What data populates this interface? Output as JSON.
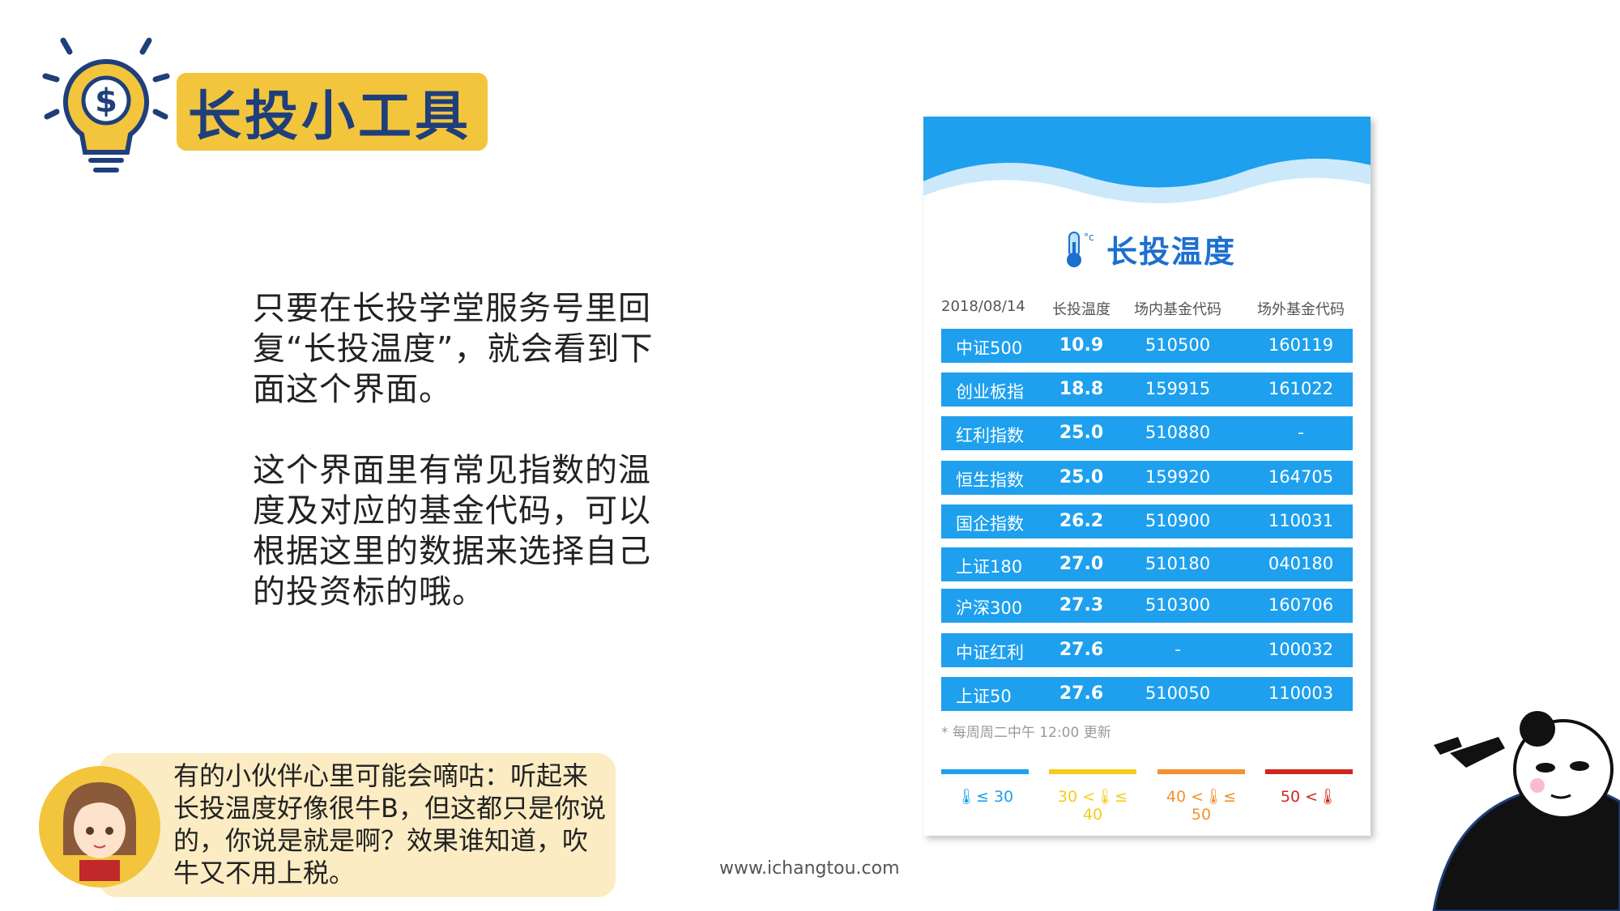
{
  "header": {
    "title": "长投小工具"
  },
  "paragraphs": [
    "只要在长投学堂服务号里回复“长投温度”，就会看到下面这个界面。",
    "这个界面里有常见指数的温度及对应的基金代码，可以根据这里的数据来选择自己的投资标的哦。"
  ],
  "bubble": {
    "text": "有的小伙伴心里可能会嘀咕：听起来长投温度好像很牛B，但这都只是你说的，你说是就是啊？效果谁知道，吹牛又不用上税。"
  },
  "footer": {
    "url": "www.ichangtou.com"
  },
  "card": {
    "title": "长投温度",
    "columns": [
      "2018/08/14",
      "长投温度",
      "场内基金代码",
      "场外基金代码"
    ],
    "rows": [
      [
        "中证500",
        "10.9",
        "510500",
        "160119"
      ],
      [
        "创业板指",
        "18.8",
        "159915",
        "161022"
      ],
      [
        "红利指数",
        "25.0",
        "510880",
        "-"
      ],
      [
        "恒生指数",
        "25.0",
        "159920",
        "164705"
      ],
      [
        "国企指数",
        "26.2",
        "510900",
        "110031"
      ],
      [
        "上证180",
        "27.0",
        "510180",
        "040180"
      ],
      [
        "沪深300",
        "27.3",
        "510300",
        "160706"
      ],
      [
        "中证红利",
        "27.6",
        "-",
        "100032"
      ],
      [
        "上证50",
        "27.6",
        "510050",
        "110003"
      ]
    ],
    "note": "* 每周周二中午 12:00 更新",
    "legend": [
      {
        "pre": "",
        "post": "≤ 30",
        "color": "#1ea0ee"
      },
      {
        "pre": "30 <",
        "post": "≤ 40",
        "color": "#f5cc1d"
      },
      {
        "pre": "40 <",
        "post": "≤ 50",
        "color": "#f39130"
      },
      {
        "pre": "50 <",
        "post": "",
        "color": "#d0261e"
      }
    ]
  }
}
